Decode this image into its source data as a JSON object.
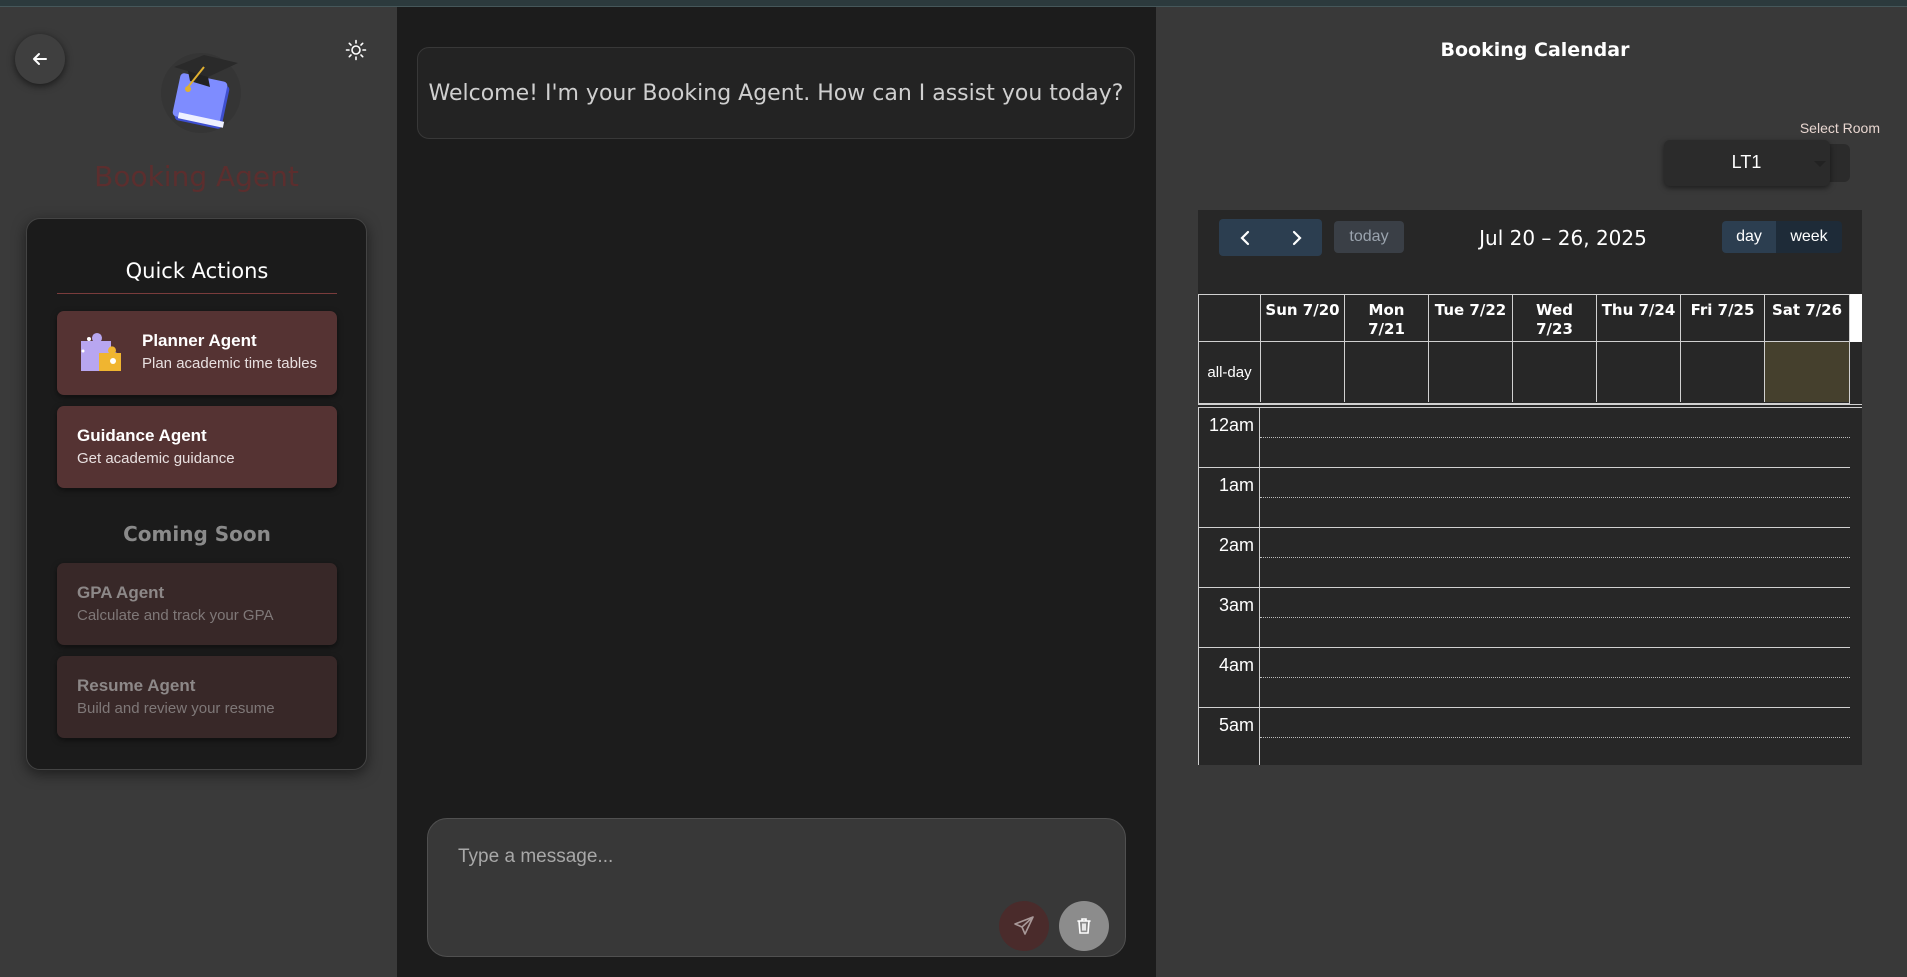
{
  "sidebar": {
    "brand": "Booking Agent",
    "quick_actions_title": "Quick Actions",
    "agents": [
      {
        "name": "Planner Agent",
        "desc": "Plan academic time tables"
      },
      {
        "name": "Guidance Agent",
        "desc": "Get academic guidance"
      }
    ],
    "coming_soon_title": "Coming Soon",
    "coming_soon": [
      {
        "name": "GPA Agent",
        "desc": "Calculate and track your GPA"
      },
      {
        "name": "Resume Agent",
        "desc": "Build and review your resume"
      }
    ]
  },
  "chat": {
    "welcome": "Welcome! I'm your Booking Agent. How can I assist you today?",
    "placeholder": "Type a message..."
  },
  "calendar": {
    "title": "Booking Calendar",
    "room_label": "Select Room",
    "room_value": "LT1",
    "today_label": "today",
    "range": "Jul 20 – 26, 2025",
    "view_day": "day",
    "view_week": "week",
    "days": [
      {
        "l1": "Sun 7/20",
        "l2": ""
      },
      {
        "l1": "Mon",
        "l2": "7/21"
      },
      {
        "l1": "Tue 7/22",
        "l2": ""
      },
      {
        "l1": "Wed",
        "l2": "7/23"
      },
      {
        "l1": "Thu 7/24",
        "l2": ""
      },
      {
        "l1": "Fri 7/25",
        "l2": ""
      },
      {
        "l1": "Sat 7/26",
        "l2": ""
      }
    ],
    "allday": "all-day",
    "times": [
      "12am",
      "1am",
      "2am",
      "3am",
      "4am",
      "5am"
    ],
    "today_highlight": "#45402d"
  }
}
